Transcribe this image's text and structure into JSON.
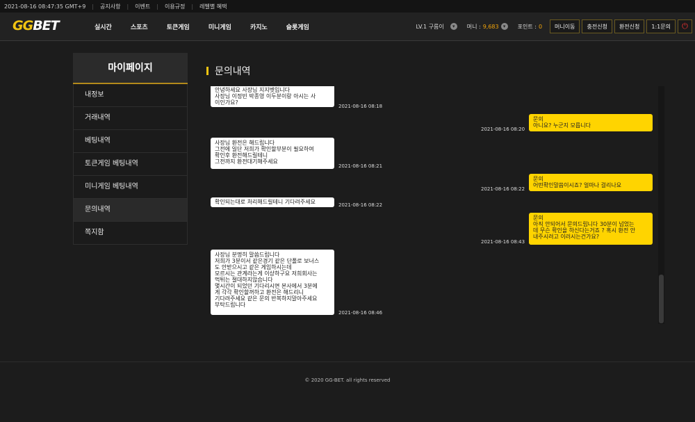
{
  "topbar": {
    "datetime": "2021-08-16 08:47:35 GMT+9",
    "links": [
      "공지사항",
      "이벤트",
      "이용규정",
      "레벨별 혜택"
    ]
  },
  "header": {
    "logo_gg": "GG",
    "logo_bet": "BET",
    "nav": [
      "실시간",
      "스포츠",
      "토큰게임",
      "미니게임",
      "카지노",
      "슬롯게임"
    ],
    "level": "LV.1 구름이",
    "money_label": "머니 :",
    "money_value": "9,683",
    "point_label": "포인트 :",
    "point_value": "0",
    "buttons": [
      "머니이동",
      "충전신청",
      "환전신청",
      "1:1문의"
    ],
    "power_icon": "power-icon"
  },
  "sidebar": {
    "title": "마이페이지",
    "items": [
      "내정보",
      "거래내역",
      "베팅내역",
      "토큰게임 베팅내역",
      "미니게임 베팅내역",
      "문의내역",
      "쪽지함"
    ],
    "active_index": 5
  },
  "page_title": "문의내역",
  "messages": [
    {
      "side": "left",
      "text": "안녕하세요 사장님 지지벳입니다\n사장님 이정빈 박종영 이두분이랑 아시는 사\n이인가요?",
      "time": "2021-08-16 08:18"
    },
    {
      "side": "right",
      "text": "문의\n아니요? 누군지 모릅니다",
      "time": "2021-08-16 08:20"
    },
    {
      "side": "left",
      "text": "사장님 환전은 해드립니다\n그전에 일단 저희가 확인할부분이 필요하여\n확인후 환전해드릴테니\n그전까지 환전대기해주세요",
      "time": "2021-08-16 08:21"
    },
    {
      "side": "right",
      "text": "문의\n어떤확인말씀이시죠? 얼마나 걸리나요",
      "time": "2021-08-16 08:22"
    },
    {
      "side": "left",
      "text": "확인되는대로  처리해드릴테니 기다려주세요",
      "time": "2021-08-16 08:22"
    },
    {
      "side": "right",
      "text": "문의\n아직 안되어서 문의드립니다 30분이 넘었는\n데 무슨 확인을 하신다는거죠 ? 혹시 환전 안\n내주시려고 이러시는건가요?",
      "time": "2021-08-16 08:43"
    },
    {
      "side": "left",
      "text": "사장님 분명히 말씀드립니다\n저희가 3분이서 같은경기 같은 단폴로 보너스\n도 안받으시고 같은 게임하시는데\n모르시는 관계라는게 이상하구요 저희회사는\n먹튀는 절대하지않습니다\n몇시간이 되었던 기다리시면 본사에서 3분에\n게 각각 확인할꺼하고 환전은 해드리니\n기다려주세요 같은 문의 반복하지말아주세요\n부탁드립니다",
      "time": "2021-08-16 08:46"
    }
  ],
  "footer": "© 2020 GG-BET. all rights reserved"
}
